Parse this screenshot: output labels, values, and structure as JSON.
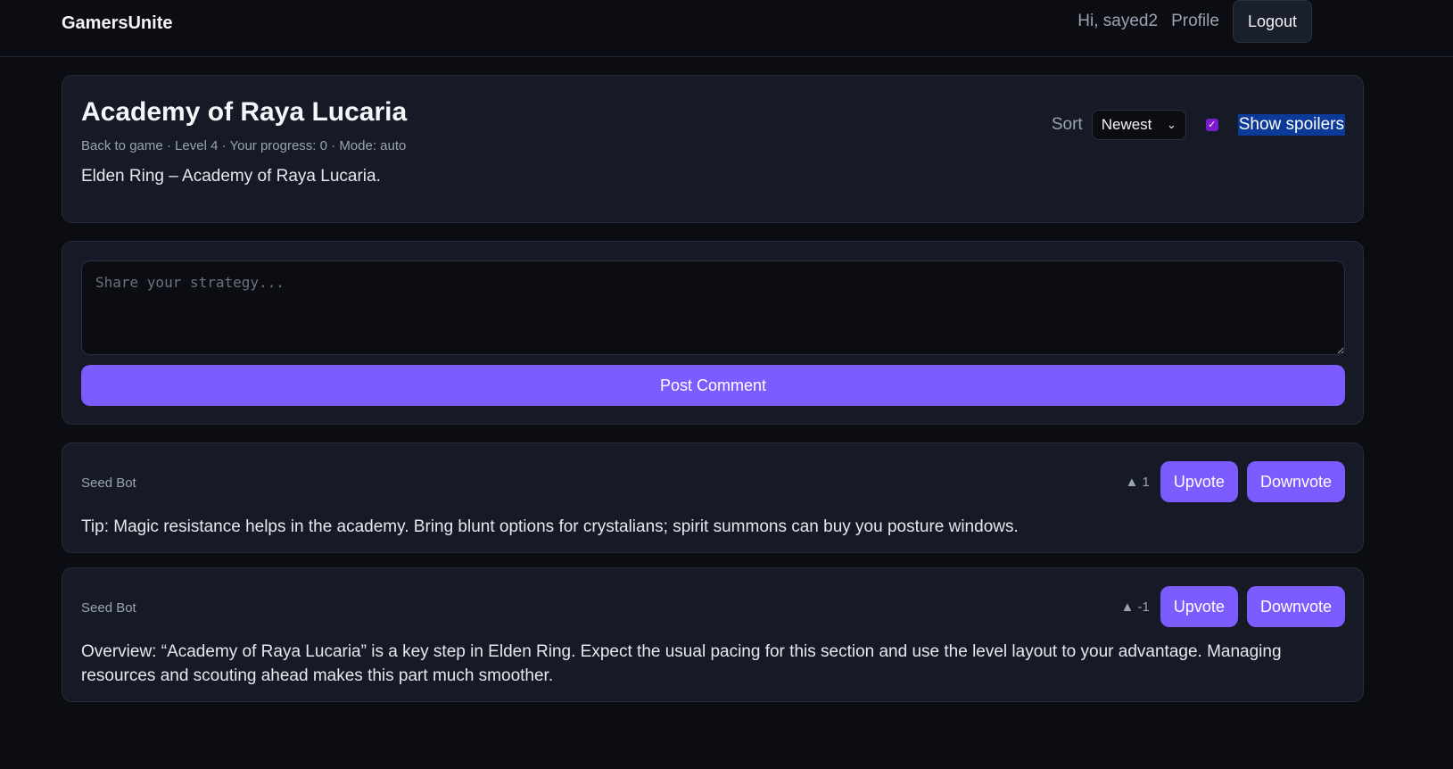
{
  "header": {
    "brand": "GamersUnite",
    "greeting": "Hi, sayed2",
    "profile_label": "Profile",
    "logout_label": "Logout"
  },
  "level": {
    "title": "Academy of Raya Lucaria",
    "meta": "Back to game · Level 4 · Your progress: 0 · Mode: auto",
    "description": "Elden Ring – Academy of Raya Lucaria."
  },
  "controls": {
    "sort_label": "Sort",
    "sort_selected": "Newest",
    "show_spoilers_checked": true,
    "show_spoilers_label": "Show spoilers"
  },
  "compose": {
    "placeholder": "Share your strategy...",
    "value": "",
    "post_label": "Post Comment"
  },
  "comments": [
    {
      "author": "Seed Bot",
      "score": "▲ 1",
      "upvote_label": "Upvote",
      "downvote_label": "Downvote",
      "text": "Tip: Magic resistance helps in the academy. Bring blunt options for crystalians; spirit summons can buy you posture windows."
    },
    {
      "author": "Seed Bot",
      "score": "▲ -1",
      "upvote_label": "Upvote",
      "downvote_label": "Downvote",
      "text": "Overview: “Academy of Raya Lucaria” is a key step in Elden Ring. Expect the usual pacing for this section and use the level layout to your advantage. Managing resources and scouting ahead makes this part much smoother."
    }
  ],
  "colors": {
    "accent": "#7c5cff",
    "background": "#0b0d12",
    "card": "#161a26",
    "checkbox": "#7a1bd0",
    "selection": "#0b3a99"
  }
}
